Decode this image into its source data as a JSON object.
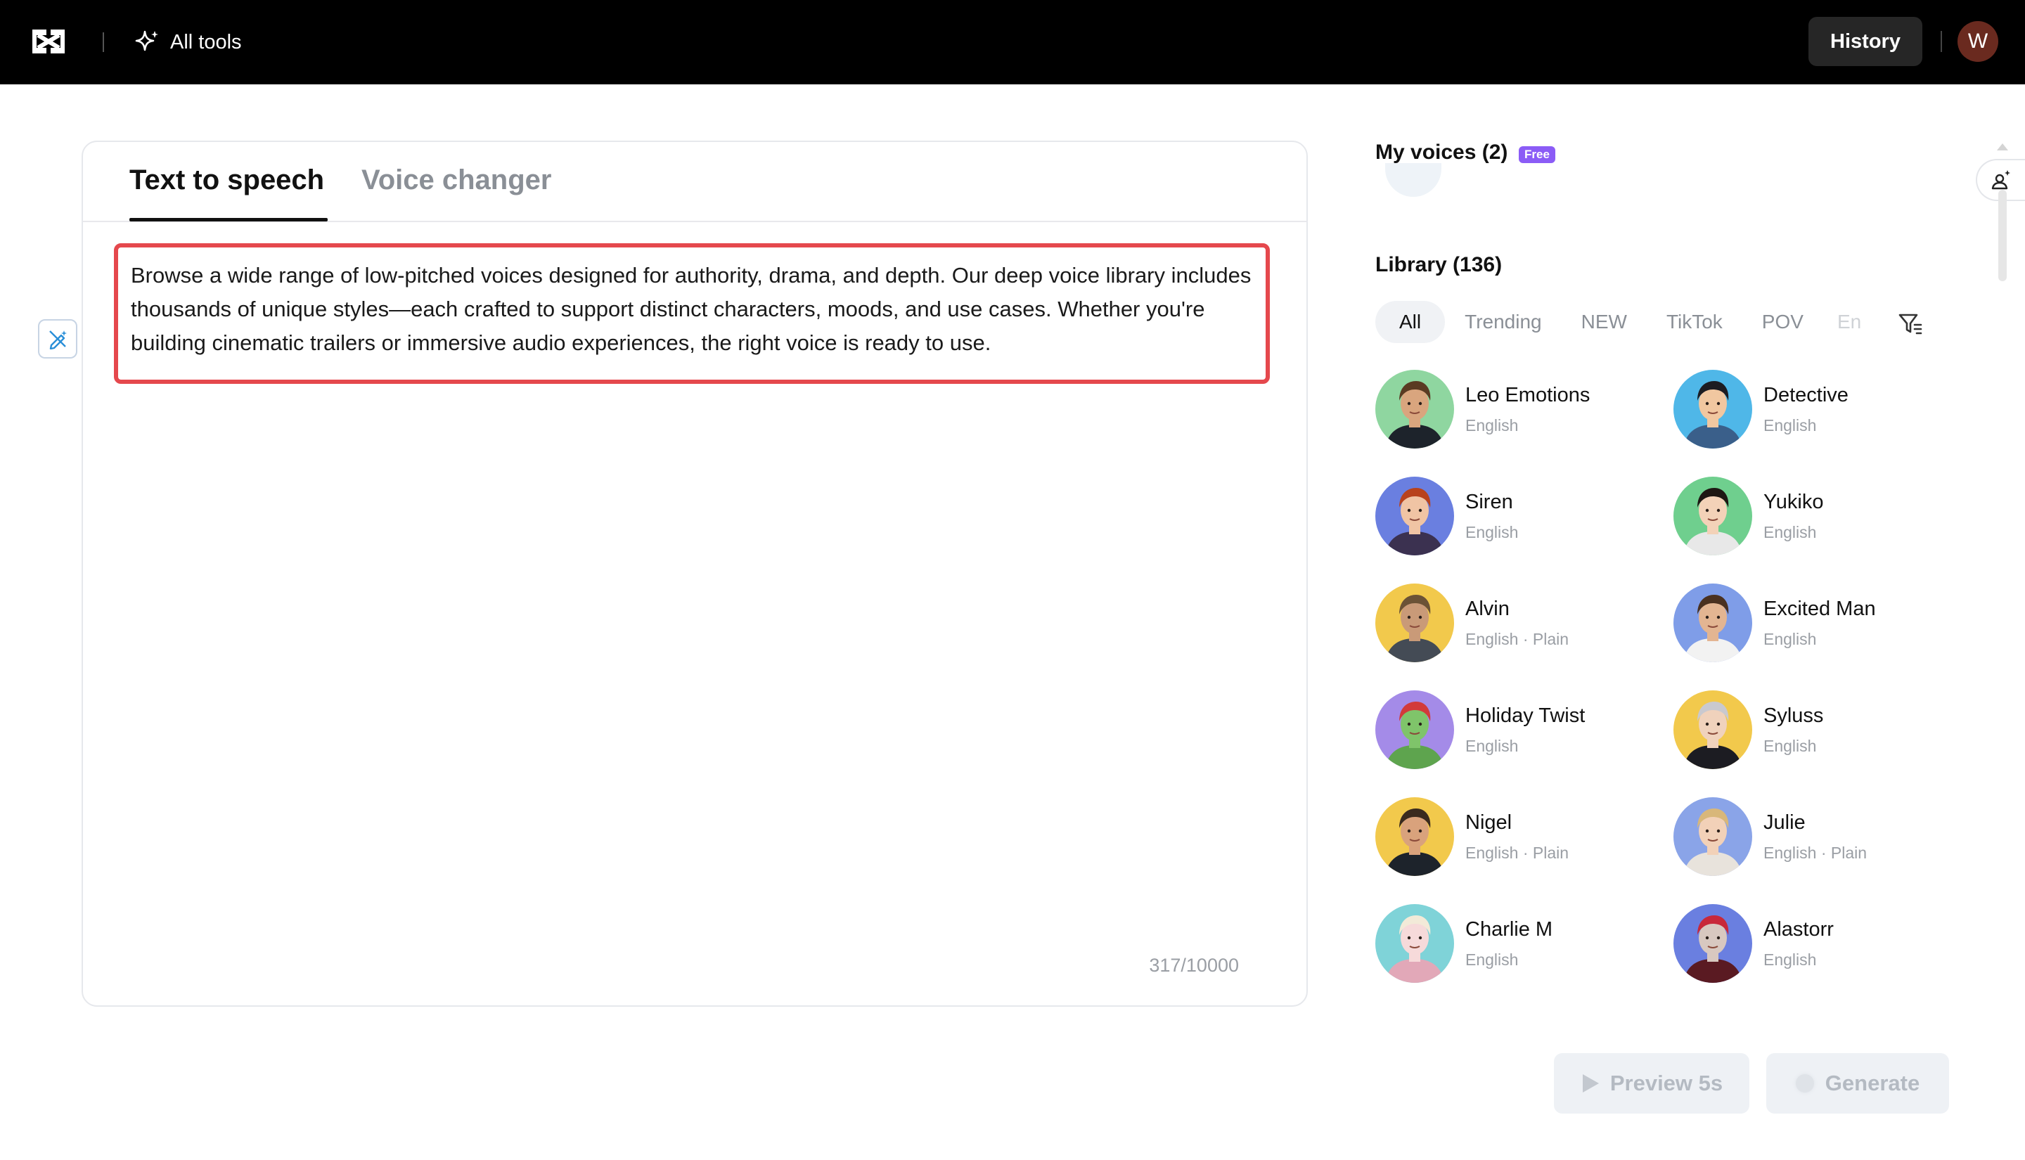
{
  "topbar": {
    "all_tools_label": "All tools",
    "history_label": "History",
    "user_initial": "W"
  },
  "editor": {
    "tabs": [
      {
        "label": "Text to speech",
        "active": true
      },
      {
        "label": "Voice changer",
        "active": false
      }
    ],
    "text": "Browse a wide range of low-pitched voices designed for authority, drama, and depth. Our deep voice library includes thousands of unique styles—each crafted to support distinct characters, moods, and use cases. Whether you're building cinematic trailers or immersive audio experiences, the right voice is ready to use.",
    "char_count": "317/10000"
  },
  "panel": {
    "my_voices_title": "My voices (2)",
    "free_badge": "Free",
    "library_title": "Library (136)",
    "filters": [
      "All",
      "Trending",
      "NEW",
      "TikTok",
      "POV",
      "En"
    ],
    "active_filter": "All",
    "voices": [
      {
        "name": "Leo Emotions",
        "meta": "English",
        "bg": "#8fd6a0",
        "skin": "#d9a57e",
        "hair": "#5a3a22",
        "cloth": "#1d232b"
      },
      {
        "name": "Detective",
        "meta": "English",
        "bg": "#4fb7e8",
        "skin": "#f1c7a0",
        "hair": "#1c1c22",
        "cloth": "#3a5f8a"
      },
      {
        "name": "Siren",
        "meta": "English",
        "bg": "#6a7fe0",
        "skin": "#f0c4a4",
        "hair": "#b8421c",
        "cloth": "#3b3150"
      },
      {
        "name": "Yukiko",
        "meta": "English",
        "bg": "#6fcf8e",
        "skin": "#f3d2b8",
        "hair": "#1e1713",
        "cloth": "#e8e8e8"
      },
      {
        "name": "Alvin",
        "meta": "English · Plain",
        "bg": "#f2c94c",
        "skin": "#c99a78",
        "hair": "#6b5236",
        "cloth": "#444b55"
      },
      {
        "name": "Excited Man",
        "meta": "English",
        "bg": "#7f9de8",
        "skin": "#e3b592",
        "hair": "#4a3120",
        "cloth": "#f2f2f2"
      },
      {
        "name": "Holiday Twist",
        "meta": "English",
        "bg": "#a48be8",
        "skin": "#7fc46a",
        "hair": "#d23a3a",
        "cloth": "#5ea44e"
      },
      {
        "name": "Syluss",
        "meta": "English",
        "bg": "#f2c94c",
        "skin": "#f0d2bc",
        "hair": "#c9c9cf",
        "cloth": "#1c1c22"
      },
      {
        "name": "Nigel",
        "meta": "English · Plain",
        "bg": "#f2c94c",
        "skin": "#d9a27c",
        "hair": "#3a2a1e",
        "cloth": "#1d232b"
      },
      {
        "name": "Julie",
        "meta": "English · Plain",
        "bg": "#8aa4e8",
        "skin": "#f2d1b8",
        "hair": "#d8b77a",
        "cloth": "#e8e3dc"
      },
      {
        "name": "Charlie M",
        "meta": "English",
        "bg": "#7fd3d8",
        "skin": "#f6dada",
        "hair": "#f2ead8",
        "cloth": "#e2a8b8"
      },
      {
        "name": "Alastorr",
        "meta": "English",
        "bg": "#6a7fe0",
        "skin": "#d8c8c0",
        "hair": "#c8283a",
        "cloth": "#5a1a22"
      }
    ]
  },
  "actions": {
    "preview_label": "Preview 5s",
    "generate_label": "Generate"
  },
  "colors": {
    "highlight_border": "#e5484d",
    "free_badge": "#8b5cf6"
  }
}
